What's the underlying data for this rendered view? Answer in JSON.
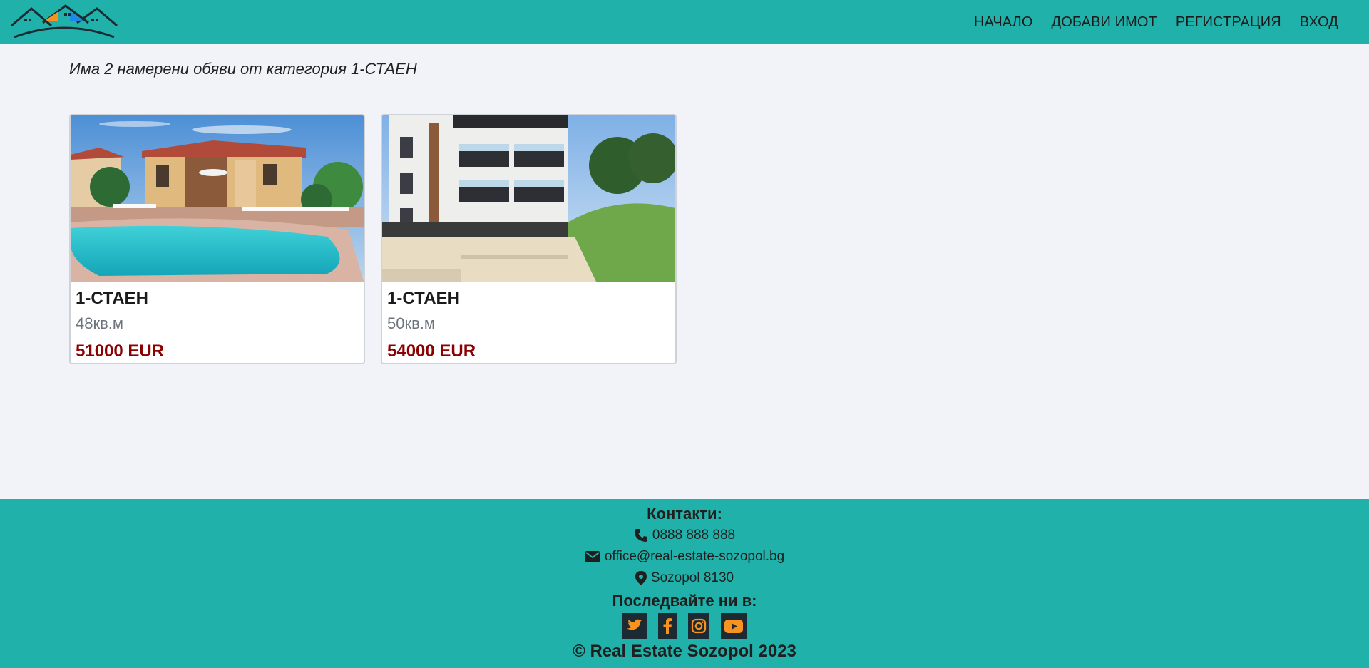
{
  "nav": {
    "links": [
      "НАЧАЛО",
      "ДОБАВИ ИМОТ",
      "РЕГИСТРАЦИЯ",
      "ВХОД"
    ]
  },
  "main": {
    "results_text": "Има 2 намерени обяви от категория 1-СТАЕН",
    "listings": [
      {
        "title": "1-СТАЕН",
        "area": "48кв.м",
        "price": "51000 EUR",
        "image": "villa-with-pool-photo"
      },
      {
        "title": "1-СТАЕН",
        "area": "50кв.м",
        "price": "54000 EUR",
        "image": "apartment-building-photo"
      }
    ]
  },
  "footer": {
    "contacts_heading": "Контакти:",
    "phone": "0888 888 888",
    "email": "office@real-estate-sozopol.bg",
    "address": "Sozopol 8130",
    "follow_heading": "Последвайте ни в:",
    "socials": [
      "twitter-icon",
      "facebook-icon",
      "instagram-icon",
      "youtube-icon"
    ],
    "copyright": "© Real Estate Sozopol 2023"
  },
  "colors": {
    "brand": "#20b2aa",
    "price": "#8b0000",
    "social_bg": "#1c2b33",
    "social_icon": "#f7931e",
    "logo_orange": "#f7931e",
    "logo_blue": "#1e88e5"
  }
}
